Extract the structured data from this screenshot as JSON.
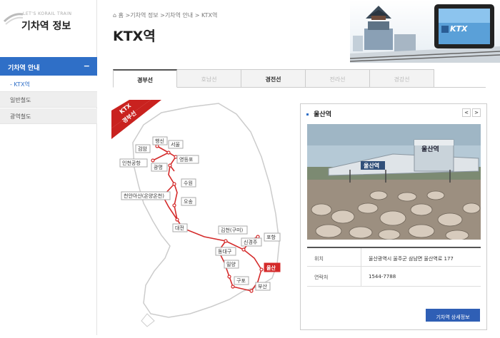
{
  "sidebar": {
    "brand_eng": "LET'S KORAIL TRAIN",
    "brand_kor": "기차역 정보",
    "main_menu": "기차역 안내",
    "main_menu_toggle": "−",
    "items": [
      {
        "label": "- KTX역"
      },
      {
        "label": "일반철도"
      },
      {
        "label": "광역철도"
      }
    ]
  },
  "breadcrumb": "홈 >기차역 정보 >기차역 안내 > KTX역",
  "page_title": "KTX역",
  "tabs": [
    {
      "label": "경부선"
    },
    {
      "label": "호남선"
    },
    {
      "label": "경전선"
    },
    {
      "label": "전라선"
    },
    {
      "label": "경강선"
    }
  ],
  "map": {
    "ribbon_line1": "KTX",
    "ribbon_line2": "경부선",
    "stations": [
      "행신",
      "서울",
      "검암",
      "영등포",
      "인천공항",
      "광명",
      "수원",
      "천안아산(온양온천)",
      "오송",
      "대전",
      "김천(구미)",
      "포항",
      "신경주",
      "동대구",
      "울산",
      "밀양",
      "구포",
      "부산"
    ],
    "selected_station": "울산"
  },
  "station_info": {
    "name": "울산역",
    "prev": "<",
    "next": ">",
    "photo_sign": "울산역",
    "location_label": "위치",
    "location_value": "울산광역시 울주군 삼남면 울산역로 177",
    "contact_label": "연락처",
    "contact_value": "1544-7788",
    "detail_button": "기차역 상세정보"
  },
  "colors": {
    "accent": "#2f6fc7",
    "route": "#d42a2a",
    "button": "#2f5fb5"
  }
}
